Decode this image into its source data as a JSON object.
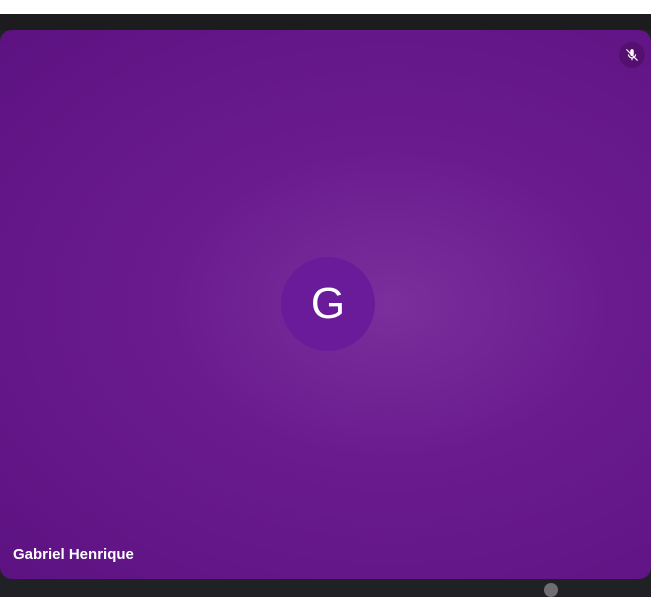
{
  "participant": {
    "name": "Gabriel Henrique",
    "initial": "G",
    "mic_status": "muted",
    "mic_icon": "mic-off-icon"
  },
  "colors": {
    "tile_center": "#7a2f9c",
    "tile_edge": "#5d1282",
    "avatar_bg": "#6a1b9a",
    "badge_bg": "#55106f",
    "frame_bg": "#202124"
  }
}
